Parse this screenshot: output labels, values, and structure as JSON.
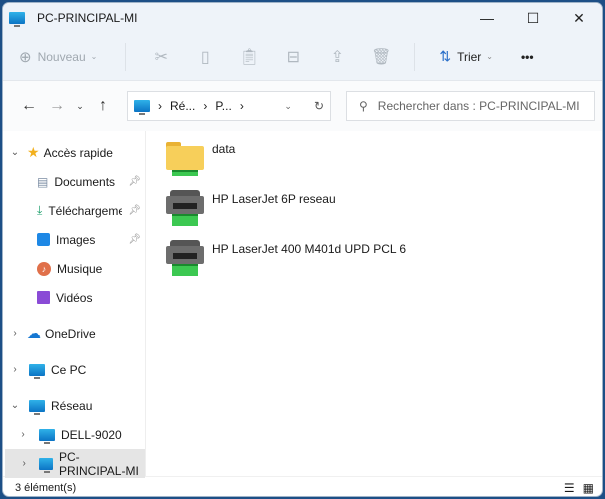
{
  "window": {
    "title": "PC-PRINCIPAL-MI"
  },
  "toolbar": {
    "new_label": "Nouveau",
    "sort_label": "Trier",
    "more": "•••"
  },
  "address": {
    "crumbs": [
      "Ré...",
      "P..."
    ],
    "search_placeholder": "Rechercher dans : PC-PRINCIPAL-MI"
  },
  "sidebar": {
    "quick_access": "Accès rapide",
    "items": [
      {
        "label": "Documents"
      },
      {
        "label": "Téléchargements"
      },
      {
        "label": "Images"
      },
      {
        "label": "Musique"
      },
      {
        "label": "Vidéos"
      }
    ],
    "onedrive": "OneDrive",
    "this_pc": "Ce PC",
    "network": "Réseau",
    "network_items": [
      {
        "label": "DELL-9020"
      },
      {
        "label": "PC-PRINCIPAL-MI"
      }
    ]
  },
  "files": [
    {
      "name": "data",
      "type": "folder"
    },
    {
      "name": "HP LaserJet 6P reseau",
      "type": "printer"
    },
    {
      "name": "HP LaserJet 400 M401d UPD PCL 6",
      "type": "printer"
    }
  ],
  "status": {
    "count": "3 élément(s)"
  }
}
